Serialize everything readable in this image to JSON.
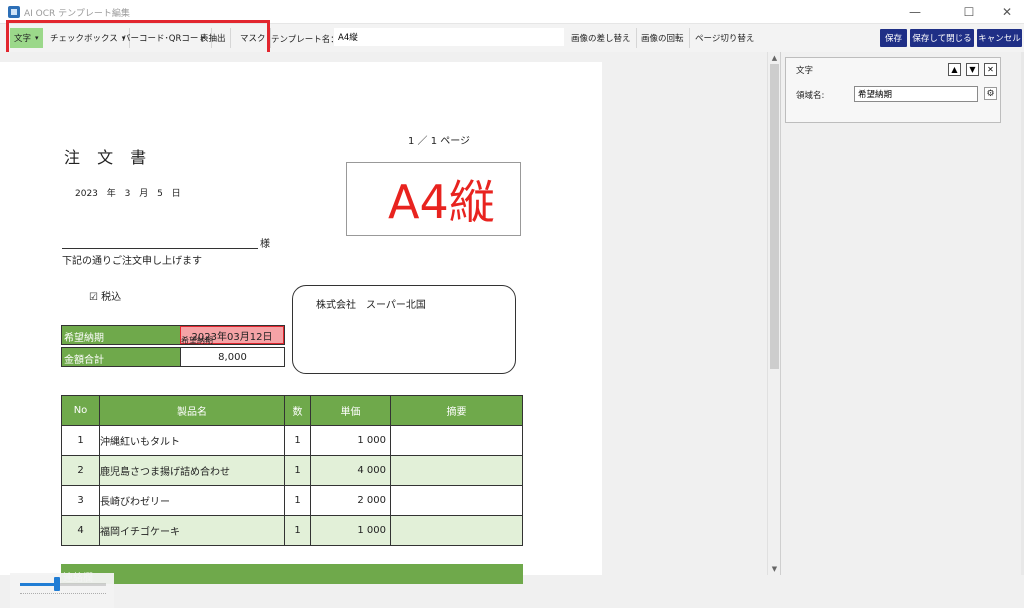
{
  "window": {
    "title": "AI OCR テンプレート編集",
    "minimize": "—",
    "maximize": "☐",
    "close": "✕"
  },
  "toolbar": {
    "tools": [
      {
        "label": "文字",
        "dropdown": true
      },
      {
        "label": "チェックボックス",
        "dropdown": true
      },
      {
        "label": "バーコード･QRコード",
        "dropdown": false
      },
      {
        "label": "表抽出",
        "dropdown": false
      },
      {
        "label": "マスク",
        "dropdown": false
      }
    ],
    "caret": "▾",
    "template_label": "テンプレート名：",
    "template_name": "A4縦",
    "replace_image": "画像の差し替え",
    "rotate_image": "画像の回転",
    "switch_page": "ページ切り替え",
    "save": "保存",
    "save_close": "保存して閉じる",
    "cancel": "キャンセル",
    "accent": "#1f2f86"
  },
  "document": {
    "title": "注 文 書",
    "date": "2023 年    3  月    5  日",
    "page": "1 ／      1 ページ",
    "stamp": "A4縦",
    "recipient_suffix": "様",
    "greeting": "下記の通りご注文申し上げます",
    "tax_included": "☑ 税込",
    "supplier": "株式会社　スーパー北国",
    "field_tag": "希望納期",
    "delivery_label": "希望納期",
    "delivery_value": "2023年03月12日",
    "total_label": "金額合計",
    "total_value": "8,000",
    "table": {
      "headers": [
        "No",
        "製品名",
        "数",
        "単価",
        "摘要"
      ],
      "rows": [
        {
          "no": "1",
          "product": "沖縄紅いもタルト",
          "qty": "1",
          "price": "1 000",
          "note": ""
        },
        {
          "no": "2",
          "product": "鹿児島さつま揚げ詰め合わせ",
          "qty": "1",
          "price": "4 000",
          "note": ""
        },
        {
          "no": "3",
          "product": "長崎びわゼリー",
          "qty": "1",
          "price": "2 000",
          "note": ""
        },
        {
          "no": "4",
          "product": "福岡イチゴケーキ",
          "qty": "1",
          "price": "1 000",
          "note": ""
        }
      ]
    },
    "contact_label": "連絡欄",
    "header_color": "#6fa94b"
  },
  "zoom": {
    "level": 0.43
  },
  "properties": {
    "type_label": "文字",
    "field_label": "領域名:",
    "field_value": "希望納期",
    "up": "▲",
    "down": "▼",
    "remove": "✕",
    "settings": "⚙"
  }
}
